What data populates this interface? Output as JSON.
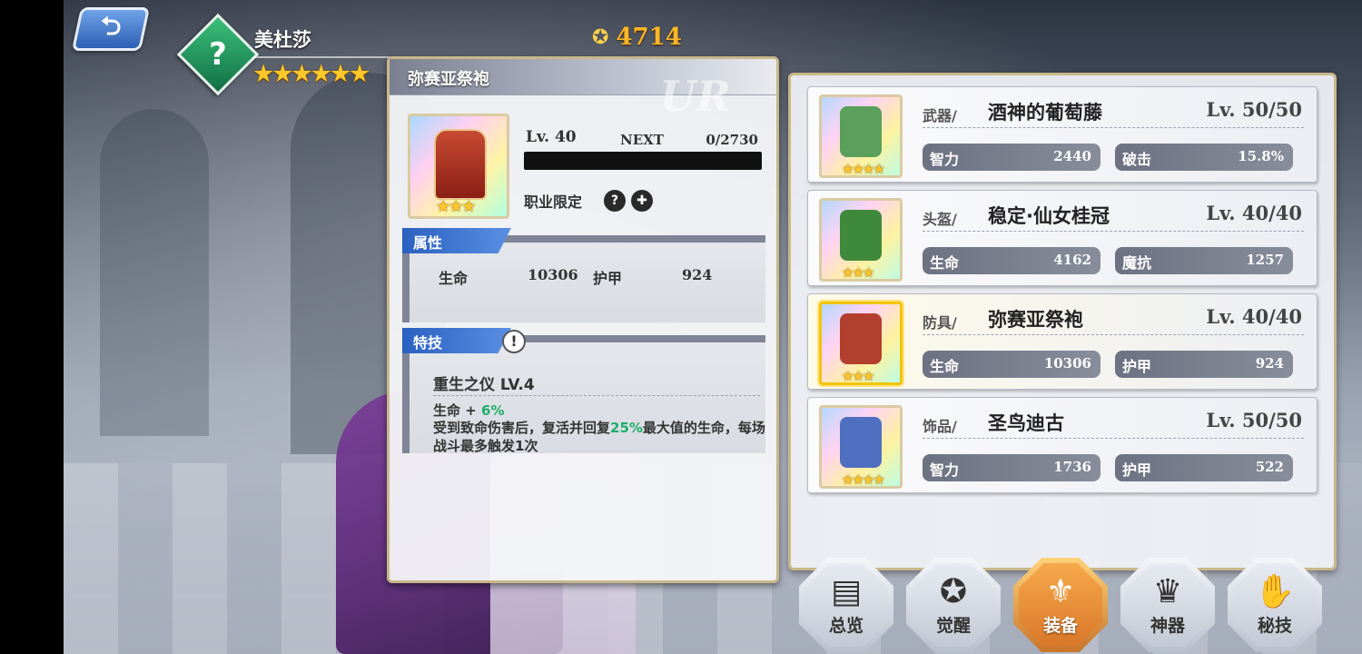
{
  "header": {
    "back_label": "⮌",
    "hero_name": "美杜莎",
    "hero_stars": "★★★★★★",
    "class_glyph": "?",
    "power_icon": "star-badge-icon",
    "power_value": "4714"
  },
  "detail": {
    "title": "弥赛亚祭袍",
    "rarity_watermark": "UR",
    "item_stars": "★★★",
    "level": "Lv. 40",
    "next_label": "NEXT",
    "exp": "0/2730",
    "exp_fraction": 0,
    "job_limit_label": "职业限定",
    "job_icons": [
      "?",
      "✚"
    ],
    "attributes_tab": "属性",
    "attributes": [
      {
        "name": "生命",
        "value": "10306"
      },
      {
        "name": "护甲",
        "value": "924"
      }
    ],
    "skill_tab": "特技",
    "skill_info_glyph": "!",
    "skill_name": "重生之仪  LV.4",
    "skill_bonus_prefix": "生命 + ",
    "skill_bonus_value": "6%",
    "skill_desc_a": "受到致命伤害后，复活并回复",
    "skill_desc_pct": "25%",
    "skill_desc_b": "最大值的生命，每场战斗最多触发1次"
  },
  "equipment": [
    {
      "type": "武器/",
      "name": "酒神的葡萄藤",
      "level": "Lv. 50/50",
      "stars": "★★★★",
      "stat1": {
        "k": "智力",
        "v": "2440"
      },
      "stat2": {
        "k": "破击",
        "v": "15.8%"
      },
      "art_color": "#5aa05a",
      "active": false
    },
    {
      "type": "头盔/",
      "name": "稳定·仙女桂冠",
      "level": "Lv. 40/40",
      "stars": "★★★",
      "stat1": {
        "k": "生命",
        "v": "4162"
      },
      "stat2": {
        "k": "魔抗",
        "v": "1257"
      },
      "art_color": "#3f8a3a",
      "active": false
    },
    {
      "type": "防具/",
      "name": "弥赛亚祭袍",
      "level": "Lv. 40/40",
      "stars": "★★★",
      "stat1": {
        "k": "生命",
        "v": "10306"
      },
      "stat2": {
        "k": "护甲",
        "v": "924"
      },
      "art_color": "#b3402e",
      "active": true
    },
    {
      "type": "饰品/",
      "name": "圣鸟迪古",
      "level": "Lv. 50/50",
      "stars": "★★★★",
      "stat1": {
        "k": "智力",
        "v": "1736"
      },
      "stat2": {
        "k": "护甲",
        "v": "522"
      },
      "art_color": "#4f6fc0",
      "active": false
    }
  ],
  "nav": [
    {
      "label": "总览",
      "glyph": "▤",
      "icon": "overview-icon",
      "active": false
    },
    {
      "label": "觉醒",
      "glyph": "✪",
      "icon": "awaken-icon",
      "active": false
    },
    {
      "label": "装备",
      "glyph": "⚜",
      "icon": "equipment-icon",
      "active": true
    },
    {
      "label": "神器",
      "glyph": "♛",
      "icon": "artifact-icon",
      "active": false
    },
    {
      "label": "秘技",
      "glyph": "✋",
      "icon": "secret-skill-icon",
      "active": false
    }
  ]
}
